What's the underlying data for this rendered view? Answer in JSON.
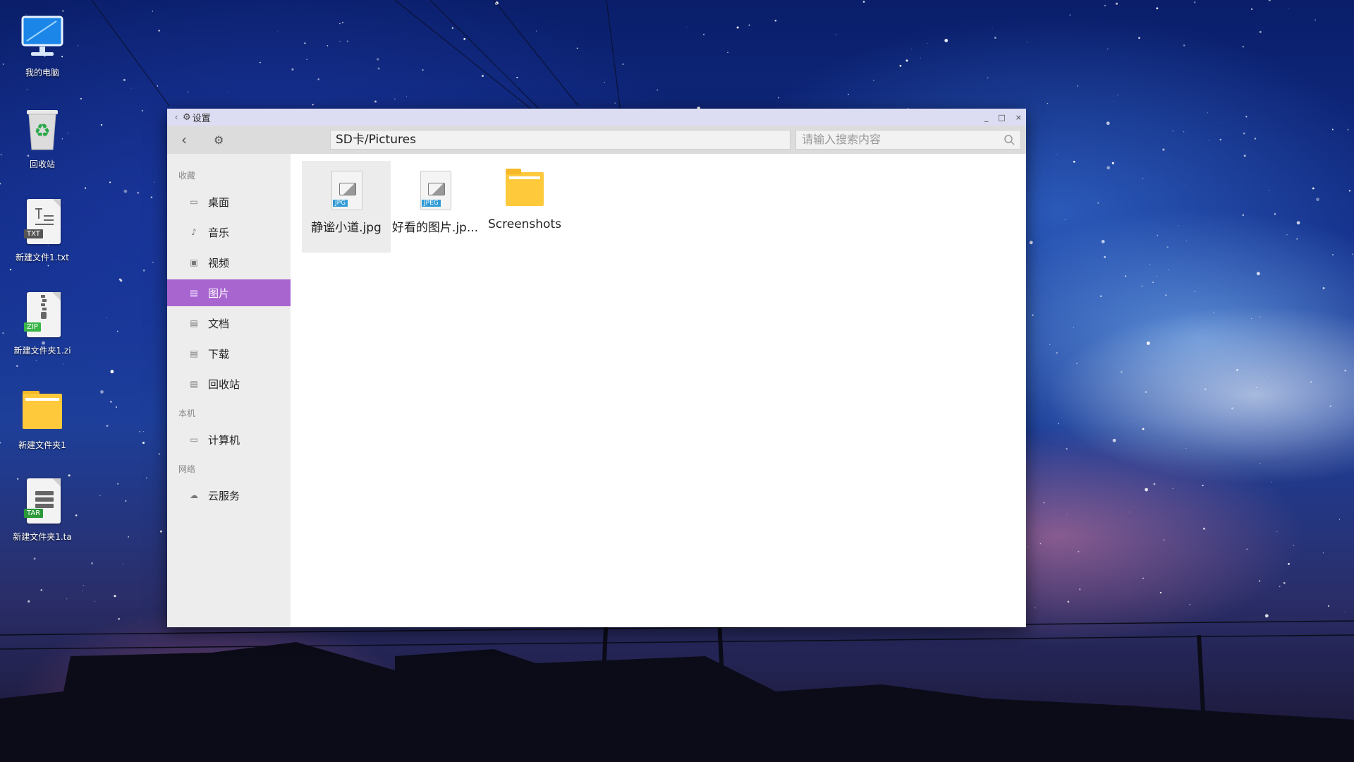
{
  "desktop": {
    "icons": [
      {
        "label": "我的电脑",
        "icon": "computer-icon"
      },
      {
        "label": "回收站",
        "icon": "recycle-bin-icon"
      },
      {
        "label": "新建文件1.txt",
        "icon": "txt-file-icon",
        "tag": "TXT"
      },
      {
        "label": "新建文件夹1.zi",
        "icon": "zip-file-icon",
        "tag": "ZIP"
      },
      {
        "label": "新建文件夹1",
        "icon": "folder-icon"
      },
      {
        "label": "新建文件夹1.ta",
        "icon": "tar-file-icon",
        "tag": "TAR"
      }
    ]
  },
  "window": {
    "title": "设置",
    "controls": {
      "minimize": "_",
      "maximize": "□",
      "close": "×"
    },
    "path": "SD卡/Pictures",
    "search_placeholder": "请输入搜索内容",
    "sidebar": {
      "sections": [
        {
          "label": "收藏",
          "items": [
            {
              "label": "桌面",
              "icon": "desktop-icon"
            },
            {
              "label": "音乐",
              "icon": "music-icon"
            },
            {
              "label": "视频",
              "icon": "video-icon"
            },
            {
              "label": "图片",
              "icon": "picture-icon",
              "active": true
            },
            {
              "label": "文档",
              "icon": "document-icon"
            },
            {
              "label": "下载",
              "icon": "download-icon"
            },
            {
              "label": "回收站",
              "icon": "trash-icon"
            }
          ]
        },
        {
          "label": "本机",
          "items": [
            {
              "label": "计算机",
              "icon": "computer-icon"
            }
          ]
        },
        {
          "label": "网络",
          "items": [
            {
              "label": "云服务",
              "icon": "cloud-icon"
            }
          ]
        }
      ]
    },
    "files": [
      {
        "name": "静谧小道.jpg",
        "type": "image",
        "tag": "JPG",
        "selected": true
      },
      {
        "name": "好看的图片.jp...",
        "type": "image",
        "tag": "JPEG",
        "selected": false
      },
      {
        "name": "Screenshots",
        "type": "folder",
        "selected": false
      }
    ]
  },
  "colors": {
    "accent": "#a865d0",
    "titlebar": "#dcdcf2",
    "folder": "#ffc93c"
  }
}
